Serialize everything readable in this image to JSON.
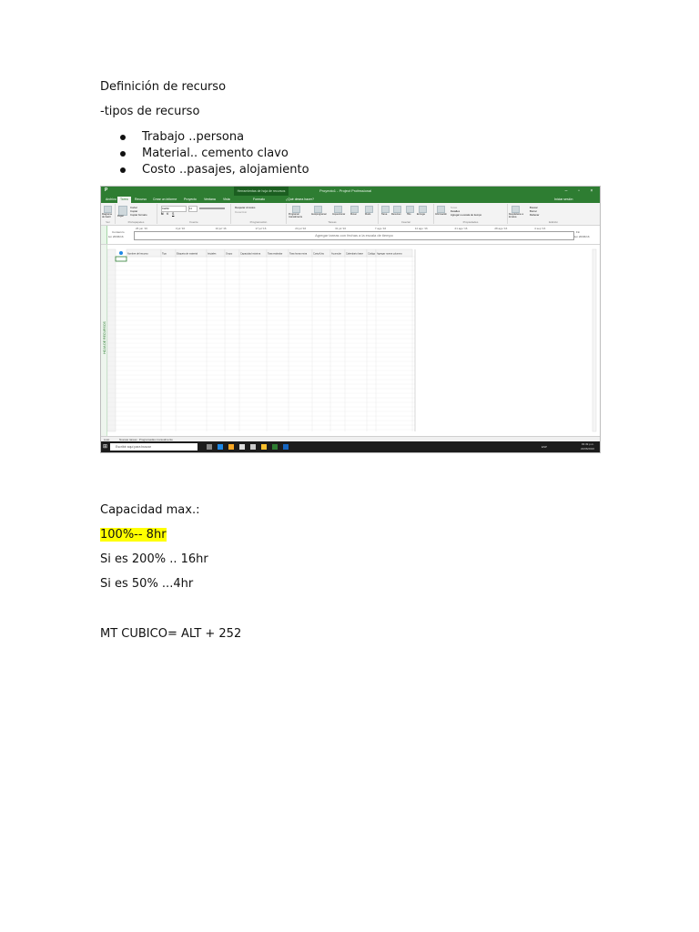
{
  "heading": "Definición de recurso",
  "subheading": "-tipos de recurso",
  "bullets": [
    "Trabajo ..persona",
    "Material.. cemento clavo",
    "Costo ..pasajes, alojamiento"
  ],
  "screenshot": {
    "window_title": "Proyecto1 - Project Professional",
    "context_tab": "Herramientas de hoja de recursos",
    "tabs": [
      "Archivo",
      "Tarea",
      "Recurso",
      "Crear un informe",
      "Proyecto",
      "Ventana",
      "Vista",
      "Formato",
      "¿Qué desea hacer?",
      "Iniciar sesión"
    ],
    "ribbon_groups": [
      "Ver",
      "Portapapeles",
      "Fuente",
      "Programación",
      "Tareas",
      "Insertar",
      "Propiedades",
      "Edición"
    ],
    "ribbon_items": {
      "paste": "Pegar",
      "cut": "Cortar",
      "copy": "Copiar",
      "copy_format": "Copiar formato",
      "gantt": "Diagrama de Gantt",
      "font": "Calibri",
      "size": "11",
      "respect": "Respetar vínculos",
      "inactivate": "Desactivar",
      "manual": "Programar manualmente",
      "auto": "Autoprogramar",
      "inspect": "Inspeccionar",
      "move": "Mover",
      "mode": "Modo",
      "task": "Tarea",
      "summary": "Resumen",
      "milestone": "Hito",
      "deliverable": "Entrega",
      "information": "Información",
      "notes": "Notas",
      "details": "Detalles",
      "add_timeline": "Agregar a escala de tiempo",
      "scroll_to": "Desplazarse a la tarea",
      "search": "Buscar",
      "clear": "Borrar",
      "fill": "Rellenar"
    },
    "timeline": {
      "placeholder": "Agregar tareas con fechas a la escala de tiempo",
      "start_label": "Comienzo",
      "start_date": "lun 20/06/16",
      "end_label": "Fin",
      "end_date": "lun 20/06/16",
      "dates": [
        "26 jun '16",
        "3 jul '16",
        "10 jul '16",
        "17 jul '16",
        "24 jul '16",
        "31 jul '16",
        "7 ago '16",
        "14 ago '16",
        "21 ago '16",
        "28 ago '16",
        "4 sep '16"
      ]
    },
    "side_label_top": "ESCALA DE TIEMPO",
    "side_label_grid": "HOJA DE RECURSOS",
    "columns": [
      "Nombre del recurso",
      "Tipo",
      "Etiqueta de material",
      "Iniciales",
      "Grupo",
      "Capacidad máxima",
      "Tasa estándar",
      "Tasa horas extra",
      "Costo/Uso",
      "Acumular",
      "Calendario base",
      "Código",
      "Agregar nueva columna"
    ],
    "status_left": "Listo",
    "status_mid": "Nuevas tareas : Programadas manualmente",
    "taskbar_search": "Escribir aquí para buscar",
    "clock_time": "03:49 p.m.",
    "clock_date": "22/06/2016",
    "lang": "ESP"
  },
  "capacidad_title": "Capacidad max.:",
  "capacidad_lines": [
    "100%-- 8hr",
    "Si es 200% .. 16hr",
    "Si es 50% ...4hr"
  ],
  "formula": "MT CUBICO= ALT + 252"
}
